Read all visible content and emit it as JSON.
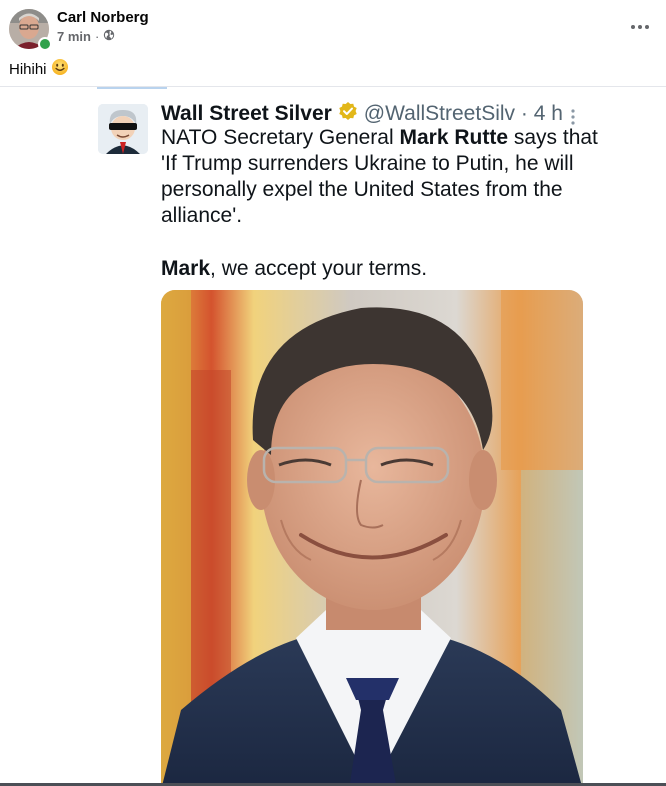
{
  "post": {
    "author": "Carl Norberg",
    "time": "7 min",
    "separator": "·",
    "caption": "Hihihi",
    "visibility_icon": "globe-icon",
    "menu_icon": "more-horizontal-icon",
    "presence_color": "#31a24c"
  },
  "tweet": {
    "name": "Wall Street Silver",
    "verified_color": "#e2b719",
    "handle_time": "@WallStreetSilv · 4 h",
    "text_parts": {
      "p1": "NATO Secretary General ",
      "p2": "Mark Rutte",
      "p3": " says that 'If Trump surrenders Ukraine to Putin, he will personally expel the United States from the alliance'."
    },
    "text2_parts": {
      "p1": "Mark",
      "p2": ", we accept your terms."
    }
  }
}
